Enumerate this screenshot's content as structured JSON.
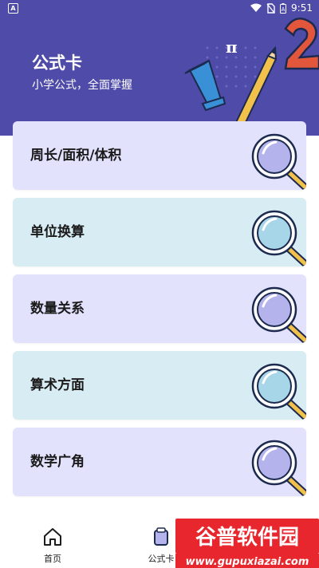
{
  "status_bar": {
    "time": "9:51",
    "app_icon_letter": "A"
  },
  "header": {
    "title": "公式卡",
    "subtitle": "小学公式，全面掌握",
    "deco_pi": "π"
  },
  "cards": [
    {
      "label": "周长/面积/体积",
      "theme": "purple"
    },
    {
      "label": "单位换算",
      "theme": "blue"
    },
    {
      "label": "数量关系",
      "theme": "purple"
    },
    {
      "label": "算术方面",
      "theme": "blue"
    },
    {
      "label": "数学广角",
      "theme": "purple"
    }
  ],
  "bottom_nav": {
    "items": [
      {
        "label": "首页",
        "icon": "home-icon"
      },
      {
        "label": "公式卡",
        "icon": "card-icon"
      }
    ]
  },
  "watermark": {
    "brand": "谷普软件园",
    "url": "www.gupuxiazai.com"
  },
  "colors": {
    "header_bg": "#4f4ba8",
    "card_purple": "#e3e2fd",
    "card_blue": "#d8edf3",
    "watermark_red": "#e8262d"
  }
}
